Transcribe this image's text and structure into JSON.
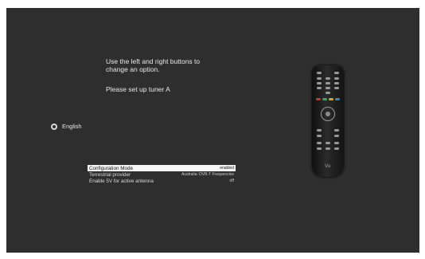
{
  "instructions": {
    "line1": "Use the left and right buttons to",
    "line2": "change an option.",
    "line3": "Please set up tuner A"
  },
  "language": {
    "label": "English",
    "icon": "radio-icon"
  },
  "config": {
    "rows": [
      {
        "label": "Configuration Mode",
        "value": "enabled",
        "selected": true
      },
      {
        "label": "Terrestrial provider",
        "value": "Australia: DVB-T Frequencies",
        "selected": false
      },
      {
        "label": "Enable 5V for active antenna",
        "value": "off",
        "selected": false
      }
    ]
  },
  "remote": {
    "logo": "Vu"
  },
  "colors": {
    "background": "#2e2e2e",
    "text": "#e8e8e8",
    "selected_row": "#f5f5f5"
  }
}
